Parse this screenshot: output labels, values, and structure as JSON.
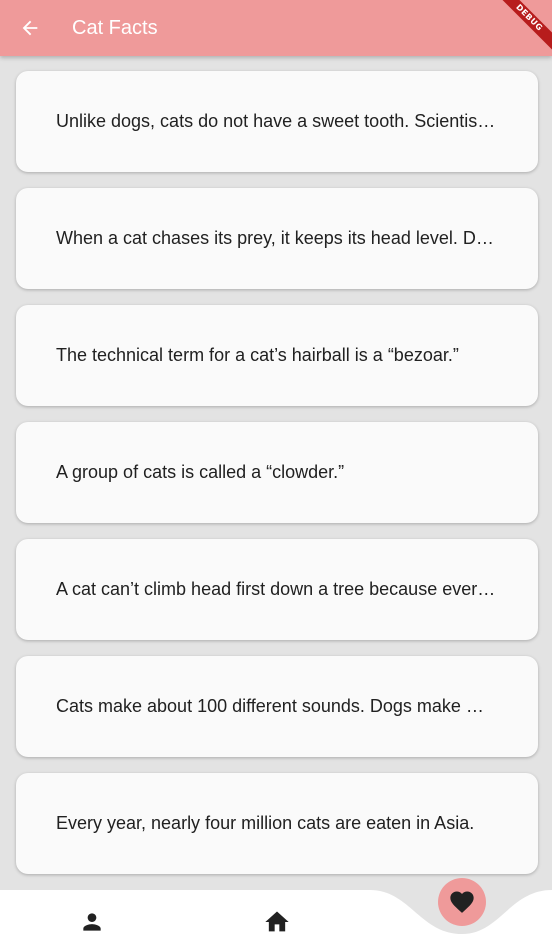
{
  "appbar": {
    "title": "Cat Facts",
    "back_icon": "arrow-back-icon",
    "debug_label": "DEBUG",
    "color": "#ef9a9a"
  },
  "facts": [
    "Unlike dogs, cats do not have a sweet tooth. Scientist…",
    "When a cat chases its prey, it keeps its head level. Do…",
    "The technical term for a cat’s hairball is a “bezoar.”",
    "A group of cats is called a “clowder.”",
    "A cat can’t climb head first down a tree because every…",
    "Cats make about 100 different sounds. Dogs make …",
    "Every year, nearly four million cats are eaten in Asia."
  ],
  "bottom_nav": {
    "items": [
      {
        "icon": "person-icon",
        "selected": false
      },
      {
        "icon": "home-icon",
        "selected": false
      },
      {
        "icon": "heart-icon",
        "selected": true
      }
    ],
    "selected_color": "#ef9a9a"
  }
}
